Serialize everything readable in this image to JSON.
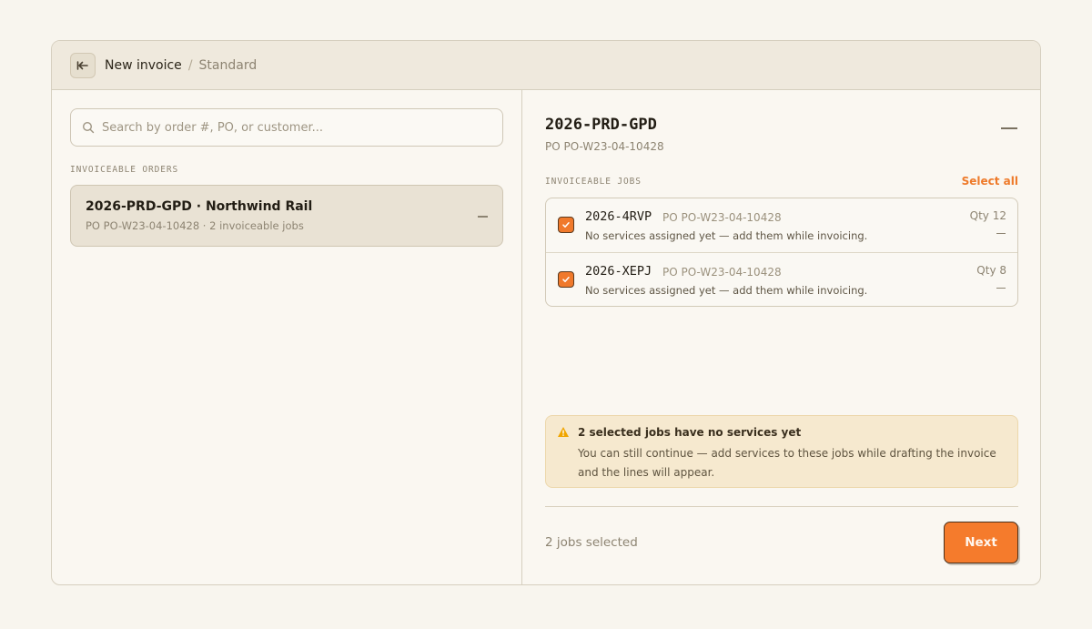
{
  "header": {
    "title": "New invoice",
    "separator": "/",
    "subtitle": "Standard"
  },
  "search": {
    "placeholder": "Search by order #, PO, or customer..."
  },
  "orders": {
    "section_label": "INVOICEABLE ORDERS",
    "items": [
      {
        "title": "2026-PRD-GPD · Northwind Rail",
        "meta": "PO PO-W23-04-10428 · 2 invoiceable jobs"
      }
    ]
  },
  "detail": {
    "title": "2026-PRD-GPD",
    "po": "PO PO-W23-04-10428",
    "jobs_label": "INVOICEABLE JOBS",
    "select_all": "Select all",
    "jobs": [
      {
        "id": "2026-4RVP",
        "po": "PO PO-W23-04-10428",
        "note": "No services assigned yet — add them while invoicing.",
        "qty": "Qty 12",
        "checked": true
      },
      {
        "id": "2026-XEPJ",
        "po": "PO PO-W23-04-10428",
        "note": "No services assigned yet — add them while invoicing.",
        "qty": "Qty 8",
        "checked": true
      }
    ]
  },
  "warning": {
    "title": "2 selected jobs have no services yet",
    "body": "You can still continue — add services to these jobs while drafting the invoice and the lines will appear."
  },
  "footer": {
    "status": "2 jobs selected",
    "next_label": "Next"
  },
  "colors": {
    "accent": "#f57b2c",
    "background": "#f8f5ee",
    "warning_bg": "#f6e9cf",
    "warning_icon": "#f0a500"
  },
  "icons": {
    "back": "arrow-left-icon",
    "search": "search-icon",
    "check": "checkmark-icon",
    "warning": "warning-triangle-icon"
  }
}
